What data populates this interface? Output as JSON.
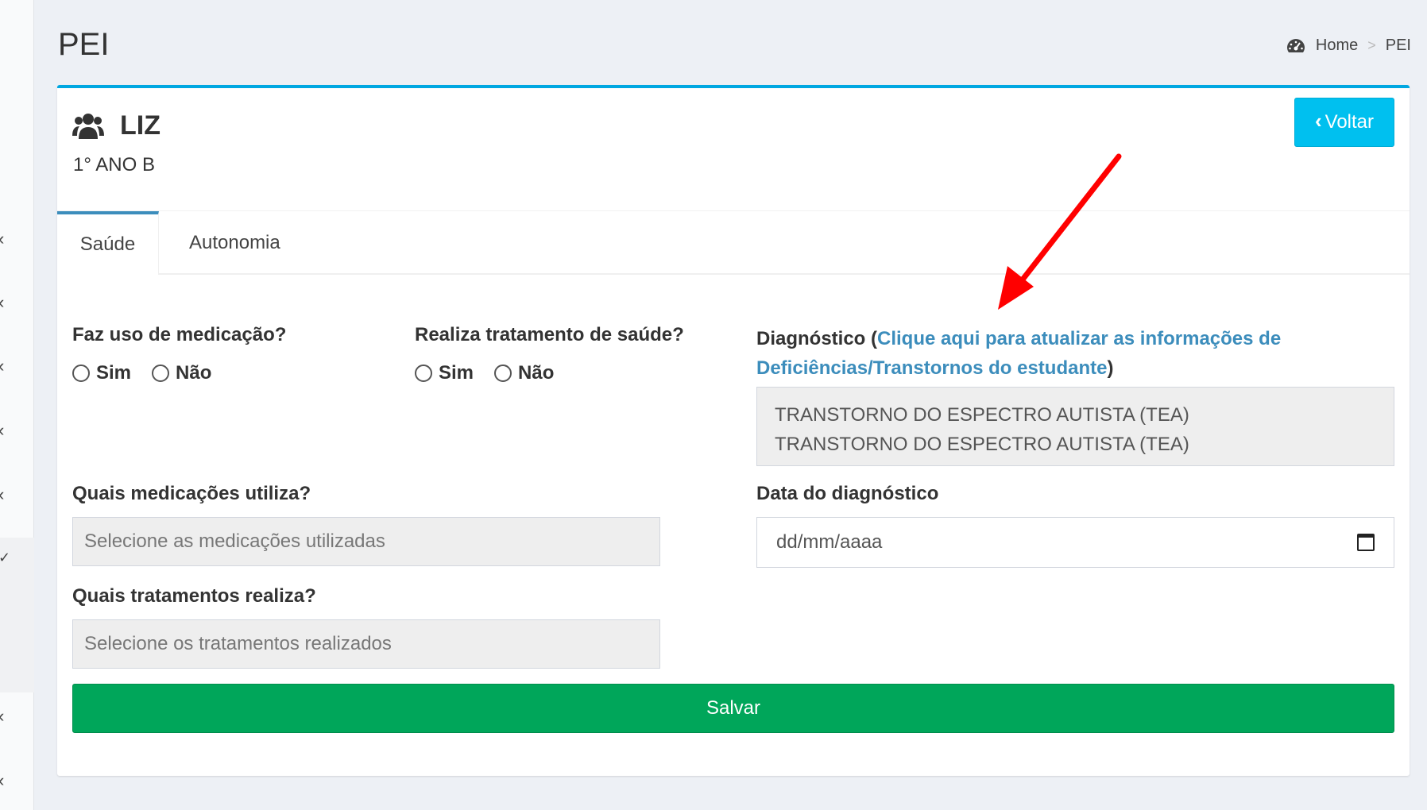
{
  "page": {
    "title": "PEI"
  },
  "breadcrumb": {
    "home": "Home",
    "separator": ">",
    "current": "PEI"
  },
  "student": {
    "name": "LIZ",
    "class": "1° ANO B"
  },
  "buttons": {
    "back": "Voltar",
    "save": "Salvar"
  },
  "tabs": [
    {
      "label": "Saúde",
      "active": true
    },
    {
      "label": "Autonomia",
      "active": false
    }
  ],
  "form": {
    "medication_question": "Faz uso de medicação?",
    "treatment_question": "Realiza tratamento de saúde?",
    "yes": "Sim",
    "no": "Não",
    "diagnosis_label": "Diagnóstico",
    "diagnosis_paren_open": "(",
    "diagnosis_link": "Clique aqui para atualizar as informações de Deficiências/Transtornos do estudante",
    "diagnosis_paren_close": ")",
    "diagnosis_values": [
      "TRANSTORNO DO ESPECTRO AUTISTA (TEA)",
      "TRANSTORNO DO ESPECTRO AUTISTA (TEA)"
    ],
    "medications_label": "Quais medicações utiliza?",
    "medications_placeholder": "Selecione as medicações utilizadas",
    "treatments_label": "Quais tratamentos realiza?",
    "treatments_placeholder": "Selecione os tratamentos realizados",
    "diagnosis_date_label": "Data do diagnóstico",
    "diagnosis_date_placeholder": "dd/mm/aaaa"
  },
  "icons": {
    "dashboard": "dashboard-icon",
    "students": "users-icon",
    "back": "chevron-left-icon",
    "calendar": "calendar-icon",
    "sidebar": "chevron-icon"
  },
  "colors": {
    "accent": "#00a7e1",
    "back_button": "#00c0ef",
    "save_button": "#00a65a",
    "link": "#3c8dbc",
    "annotation_arrow": "#ff0000"
  }
}
